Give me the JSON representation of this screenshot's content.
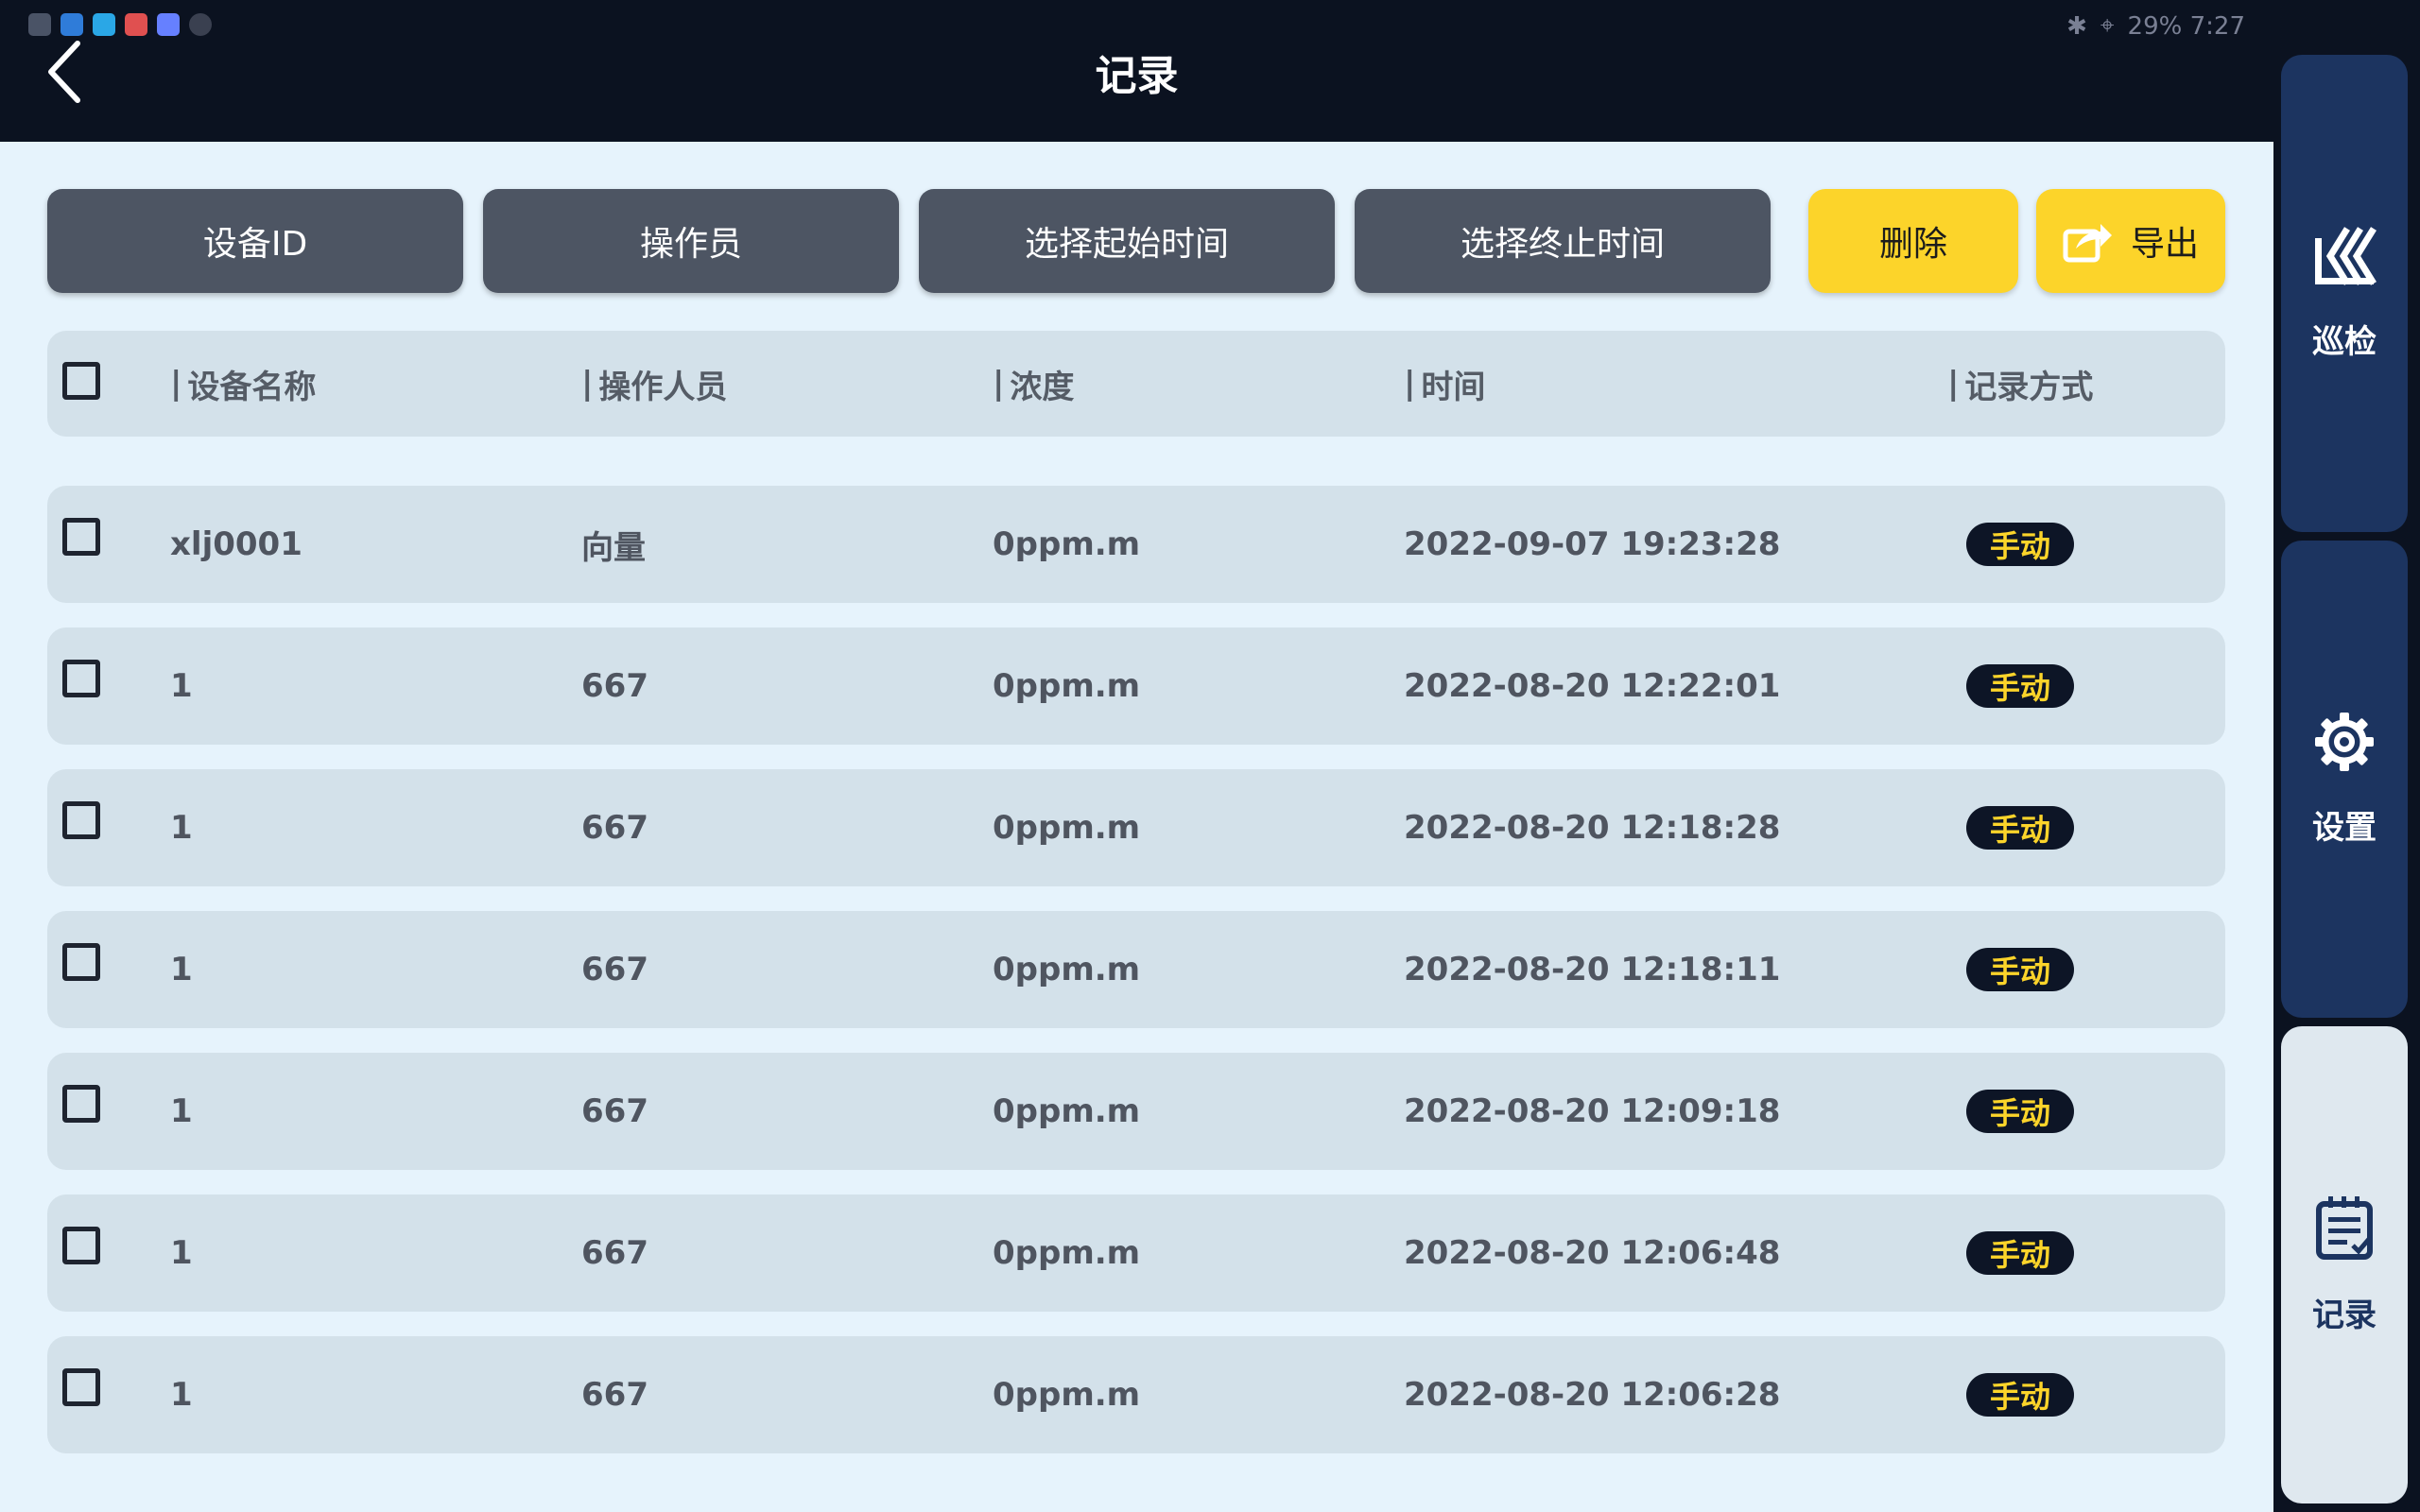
{
  "status_bar": {
    "right_text": "29%  7:27"
  },
  "header": {
    "title": "记录"
  },
  "filters": {
    "device_id": "设备ID",
    "operator": "操作员",
    "start_time": "选择起始时间",
    "end_time": "选择终止时间"
  },
  "actions": {
    "delete": "删除",
    "export": "导出"
  },
  "table": {
    "headers": [
      "设备名称",
      "操作人员",
      "浓度",
      "时间",
      "记录方式"
    ],
    "rows": [
      [
        "xlj0001",
        "向量",
        "0ppm.m",
        "2022-09-07 19:23:28",
        "手动"
      ],
      [
        "1",
        "667",
        "0ppm.m",
        "2022-08-20 12:22:01",
        "手动"
      ],
      [
        "1",
        "667",
        "0ppm.m",
        "2022-08-20 12:18:28",
        "手动"
      ],
      [
        "1",
        "667",
        "0ppm.m",
        "2022-08-20 12:18:11",
        "手动"
      ],
      [
        "1",
        "667",
        "0ppm.m",
        "2022-08-20 12:09:18",
        "手动"
      ],
      [
        "1",
        "667",
        "0ppm.m",
        "2022-08-20 12:06:48",
        "手动"
      ],
      [
        "1",
        "667",
        "0ppm.m",
        "2022-08-20 12:06:28",
        "手动"
      ]
    ]
  },
  "sidenav": {
    "items": [
      {
        "label": "巡检",
        "icon": "inspection-icon",
        "active": false
      },
      {
        "label": "设置",
        "icon": "gear-icon",
        "active": false
      },
      {
        "label": "记录",
        "icon": "record-icon",
        "active": true
      }
    ]
  },
  "colors": {
    "primary_dark": "#0b1220",
    "nav_blue": "#1c3460",
    "accent_yellow": "#fcd42a",
    "filter_gray": "#4d5563",
    "row_bg": "#d3e1ea",
    "page_bg": "#e6f3fc"
  }
}
